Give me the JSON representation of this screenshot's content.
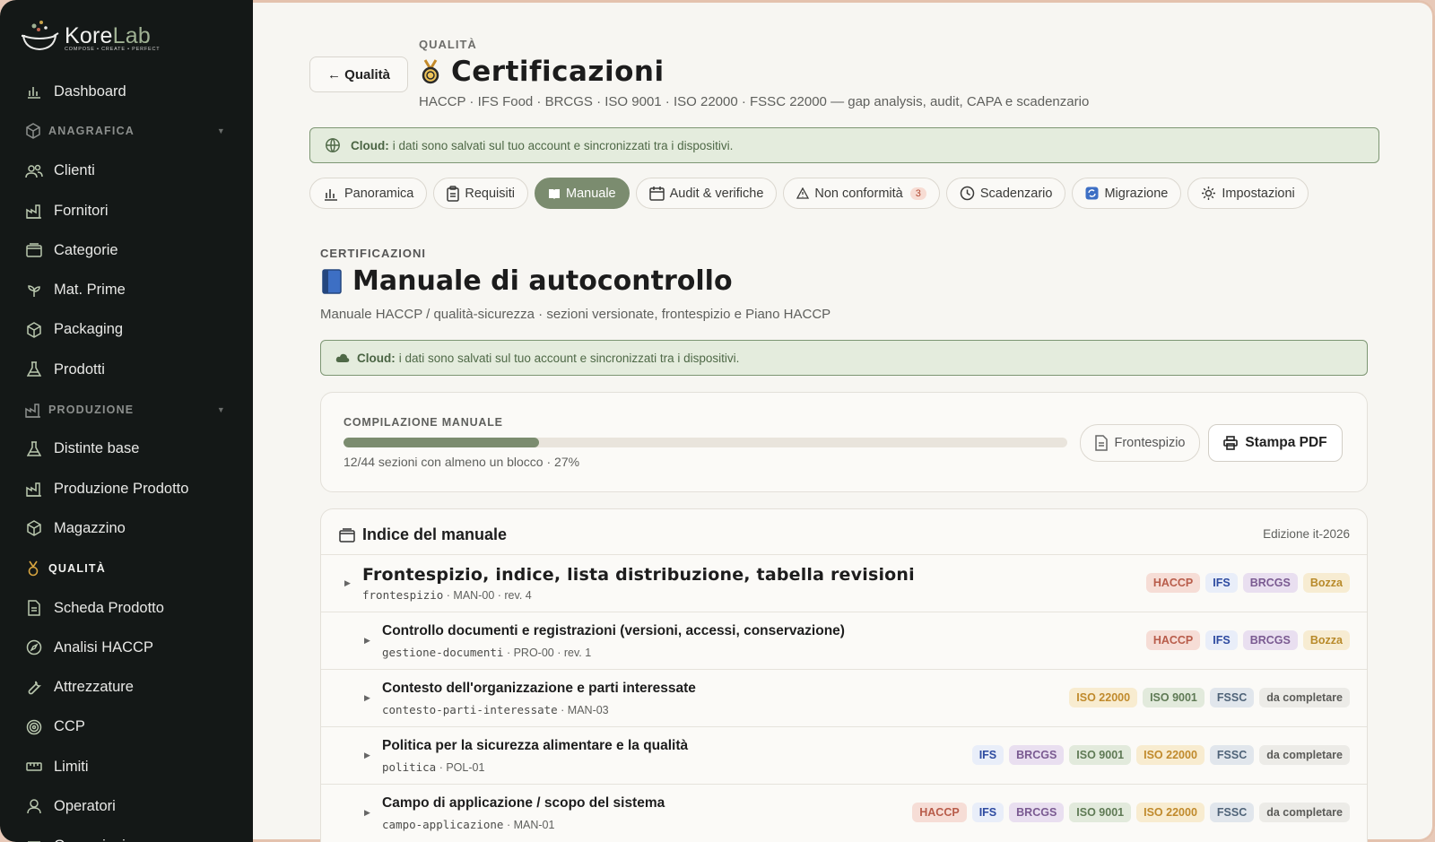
{
  "brand": {
    "name_a": "Kore",
    "name_b": "Lab",
    "tagline": "COMPOSE • CREATE • PERFECT"
  },
  "sidebar": {
    "items": [
      {
        "type": "item",
        "name": "dashboard",
        "label": "Dashboard",
        "icon": "chart-icon"
      },
      {
        "type": "section",
        "name": "anagrafica",
        "label": "ANAGRAFICA",
        "icon": "box-icon"
      },
      {
        "type": "item",
        "name": "clienti",
        "label": "Clienti",
        "icon": "users-icon"
      },
      {
        "type": "item",
        "name": "fornitori",
        "label": "Fornitori",
        "icon": "factory-icon"
      },
      {
        "type": "item",
        "name": "categorie",
        "label": "Categorie",
        "icon": "folder-icon"
      },
      {
        "type": "item",
        "name": "mat-prime",
        "label": "Mat. Prime",
        "icon": "sprout-icon"
      },
      {
        "type": "item",
        "name": "packaging",
        "label": "Packaging",
        "icon": "box-icon"
      },
      {
        "type": "item",
        "name": "prodotti",
        "label": "Prodotti",
        "icon": "flask-icon"
      },
      {
        "type": "section",
        "name": "produzione",
        "label": "PRODUZIONE",
        "icon": "factory-icon"
      },
      {
        "type": "item",
        "name": "distinte-base",
        "label": "Distinte base",
        "icon": "flask-icon"
      },
      {
        "type": "item",
        "name": "produzione-prodotto",
        "label": "Produzione Prodotto",
        "icon": "factory-icon"
      },
      {
        "type": "item",
        "name": "magazzino",
        "label": "Magazzino",
        "icon": "box-icon"
      },
      {
        "type": "section",
        "name": "qualita",
        "label": "QUALITÀ",
        "icon": "medal-icon",
        "active": true
      },
      {
        "type": "item",
        "name": "scheda-prodotto",
        "label": "Scheda Prodotto",
        "icon": "document-icon"
      },
      {
        "type": "item",
        "name": "analisi-haccp",
        "label": "Analisi HACCP",
        "icon": "compass-icon"
      },
      {
        "type": "item",
        "name": "attrezzature",
        "label": "Attrezzature",
        "icon": "wrench-icon"
      },
      {
        "type": "item",
        "name": "ccp",
        "label": "CCP",
        "icon": "target-icon"
      },
      {
        "type": "item",
        "name": "limiti",
        "label": "Limiti",
        "icon": "ruler-icon"
      },
      {
        "type": "item",
        "name": "operatori",
        "label": "Operatori",
        "icon": "user-icon"
      },
      {
        "type": "item",
        "name": "operazioni",
        "label": "Operazioni",
        "icon": "list-icon"
      }
    ]
  },
  "header": {
    "back_label": "← Qualità",
    "eyebrow": "QUALITÀ",
    "title": "Certificazioni",
    "subtitle": "HACCP · IFS Food · BRCGS · ISO 9001 · ISO 22000 · FSSC 22000 — gap analysis, audit, CAPA e scadenzario"
  },
  "cloud_banner_1": {
    "bold": "Cloud:",
    "text": "i dati sono salvati sul tuo account e sincronizzati tra i dispositivi."
  },
  "tabs": [
    {
      "name": "panoramica",
      "label": "Panoramica",
      "icon": "chart-icon"
    },
    {
      "name": "requisiti",
      "label": "Requisiti",
      "icon": "clipboard-icon"
    },
    {
      "name": "manuale",
      "label": "Manuale",
      "icon": "book-icon",
      "active": true
    },
    {
      "name": "audit",
      "label": "Audit & verifiche",
      "icon": "calendar-icon"
    },
    {
      "name": "non-conformita",
      "label": "Non conformità",
      "icon": "warning-icon",
      "badge": "3"
    },
    {
      "name": "scadenzario",
      "label": "Scadenzario",
      "icon": "clock-icon"
    },
    {
      "name": "migrazione",
      "label": "Migrazione",
      "icon": "sync-icon"
    },
    {
      "name": "impostazioni",
      "label": "Impostazioni",
      "icon": "gear-icon"
    }
  ],
  "manual": {
    "eyebrow": "CERTIFICAZIONI",
    "title": "Manuale di autocontrollo",
    "subtitle": "Manuale HACCP / qualità-sicurezza · sezioni versionate, frontespizio e Piano HACCP"
  },
  "cloud_banner_2": {
    "bold": "Cloud:",
    "text": "i dati sono salvati sul tuo account e sincronizzati tra i dispositivi."
  },
  "progress": {
    "label": "COMPILAZIONE MANUALE",
    "fraction": 0.27,
    "text": "12/44 sezioni con almeno un blocco · 27%",
    "frontespizio_label": "Frontespizio",
    "print_label": "Stampa PDF"
  },
  "index": {
    "title": "Indice del manuale",
    "edition": "Edizione it-2026",
    "rows": [
      {
        "title": "Frontespizio, indice, lista distribuzione, tabella revisioni",
        "code": "frontespizio",
        "ref": "· MAN-00 · rev. 4",
        "big": true,
        "chips": [
          "HACCP",
          "IFS",
          "BRCGS",
          "Bozza"
        ]
      },
      {
        "title": "Controllo documenti e registrazioni (versioni, accessi, conservazione)",
        "code": "gestione-documenti",
        "ref": "· PRO-00 · rev. 1",
        "chips": [
          "HACCP",
          "IFS",
          "BRCGS",
          "Bozza"
        ]
      },
      {
        "title": "Contesto dell'organizzazione e parti interessate",
        "code": "contesto-parti-interessate",
        "ref": "· MAN-03",
        "chips": [
          "ISO 22000",
          "ISO 9001",
          "FSSC",
          "da completare"
        ]
      },
      {
        "title": "Politica per la sicurezza alimentare e la qualità",
        "code": "politica",
        "ref": "· POL-01",
        "chips": [
          "IFS",
          "BRCGS",
          "ISO 9001",
          "ISO 22000",
          "FSSC",
          "da completare"
        ]
      },
      {
        "title": "Campo di applicazione / scopo del sistema",
        "code": "campo-applicazione",
        "ref": "· MAN-01",
        "chips": [
          "HACCP",
          "IFS",
          "BRCGS",
          "ISO 9001",
          "ISO 22000",
          "FSSC",
          "da completare"
        ]
      }
    ]
  },
  "chip_colors": {
    "HACCP": [
      "#f6ddd6",
      "#b85c4a"
    ],
    "IFS": [
      "#e9eef9",
      "#2d4aa0"
    ],
    "BRCGS": [
      "#e9dff0",
      "#7a5a91"
    ],
    "ISO 9001": [
      "#e2eadc",
      "#5f7a55"
    ],
    "ISO 22000": [
      "#f8ecd0",
      "#c08a2c"
    ],
    "FSSC": [
      "#e1e6ec",
      "#4f6378"
    ],
    "Bozza": [
      "#f7ecd2",
      "#b88a2a"
    ],
    "da completare": [
      "#ecebe7",
      "#5b5b58"
    ]
  }
}
